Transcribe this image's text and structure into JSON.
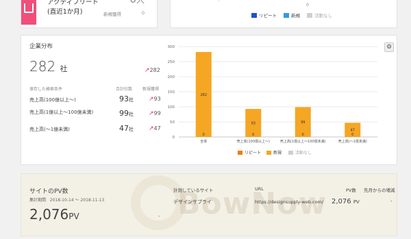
{
  "top_card": {
    "title_line1": "アクティブリード",
    "title_line2": "(直近1か月)",
    "count": "0",
    "count_unit": "人",
    "sub_label": "新規獲得",
    "sub_value": "0"
  },
  "top_chart": {
    "axis_zero": "0",
    "legend": [
      {
        "label": "リピート",
        "color": "#1f4fd6",
        "muted": false
      },
      {
        "label": "新規",
        "color": "#2e9be6",
        "muted": false
      },
      {
        "label": "活動なし",
        "color": "#cfcfcf",
        "muted": true
      }
    ]
  },
  "company_dist": {
    "title": "企業分布",
    "total": "282",
    "total_unit": "社",
    "total_new": "282",
    "col_condition": "保存した検索条件",
    "col_total": "合計社数",
    "col_new": "新規獲得",
    "rows": [
      {
        "label": "売上高(100億以上〜)",
        "count": "93",
        "unit": "社",
        "new": "93"
      },
      {
        "label": "売上高(1億以上〜100億未満)",
        "count": "99",
        "unit": "社",
        "new": "99"
      },
      {
        "label": "売上高(〜1億未満)",
        "count": "47",
        "unit": "社",
        "new": "47"
      }
    ],
    "settings_icon": "gear-icon"
  },
  "chart_data": {
    "type": "bar",
    "categories": [
      "全体",
      "売上高(100億以上〜)",
      "売上高(1億以上〜100億未満)",
      "売上高(〜1億未満)"
    ],
    "series": [
      {
        "name": "リピート",
        "values": [
          0,
          0,
          0,
          0
        ],
        "color": "#f07b0c"
      },
      {
        "name": "新規",
        "values": [
          282,
          93,
          99,
          47
        ],
        "color": "#f5a623"
      },
      {
        "name": "活動なし",
        "values": [
          0,
          0,
          0,
          0
        ],
        "color": "#cfcfcf"
      }
    ],
    "ylim": [
      0,
      300
    ],
    "yticks": [
      0,
      50,
      100,
      150,
      200,
      250,
      300
    ],
    "grid": true,
    "legend_position": "bottom"
  },
  "site_pv": {
    "title": "サイトのPV数",
    "period_label": "集計期間",
    "period_value": "2018-10-14 〜 2018-11-13",
    "total": "2,076",
    "total_unit": "PV",
    "dash": "-",
    "col_site": "計測しているサイト",
    "col_url": "URL",
    "col_pv": "PV数",
    "col_prev": "先月からの増減",
    "rows": [
      {
        "site": "デザインサプライ",
        "url": "https://designsupply-web.com/",
        "pv": "2,076",
        "pv_unit": "PV",
        "change": "-"
      }
    ],
    "watermark": "BowNow"
  }
}
